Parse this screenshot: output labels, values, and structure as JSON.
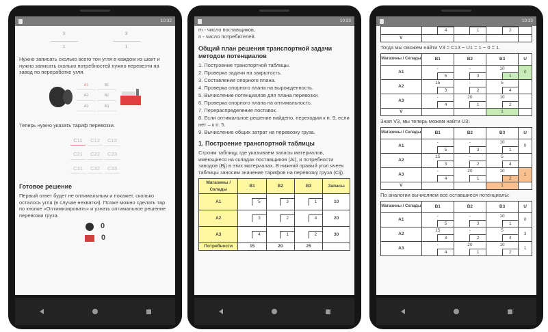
{
  "status": {
    "time1": "10:32",
    "time2": "10:33",
    "time3": "10:33"
  },
  "phone1": {
    "fractions": [
      [
        "3",
        "1"
      ],
      [
        "3",
        "1"
      ]
    ],
    "text1": "Нужно записать сколько всего тон угля в каждом из шахт и нужно записать сколько потребностей нужно перевезти на завод по переработке угля.",
    "mini_cells": [
      "A1",
      "B1",
      "A2",
      "B2",
      "A3",
      "B3"
    ],
    "text2": "Теперь нужно указать тариф перевозки.",
    "tariffs": [
      "C11",
      "C12",
      "C13",
      "C21",
      "C22",
      "C23",
      "C31",
      "C32",
      "C33"
    ],
    "heading": "Готовое решение",
    "text3": "Первый ответ будет не оптимальным и покажет, сколько осталось угля (в случае нехватки). Позже можно сделать тар по кнопке «Оптимизировать» и узнать оптимальное решение перевозки груза.",
    "result1": "0",
    "result2": "0"
  },
  "phone2": {
    "top1": "m - число поставщиков,",
    "top2": "n - число потребителей.",
    "heading1": "Общий план решения транспортной задачи методом потенциалов",
    "steps": [
      "1. Построение транспортной таблицы.",
      "2. Проверка задачи на закрытость.",
      "3. Составление опорного плана.",
      "4. Проверка опорного плана на вырожденность.",
      "5. Вычисление потенциалов для плана перевозки.",
      "6. Проверка опорного плана на оптимальность.",
      "7. Перераспределение поставок.",
      "8. Если оптимальное решение найдено, переходим к п. 9, если нет – к п. 5.",
      "9. Вычисление общих затрат на перевозку груза."
    ],
    "heading2": "1. Построение транспортной таблицы",
    "text": "Строим таблицу, где указываем запасы материалов, имеющиеся на складах поставщиков (Ai), и потребности заводов (Bj) в этих материалах. В нижний правый угол ячеек таблицы заносим значение тарифов на перевозку груза (Cij).",
    "table": {
      "corner": "Магазины / Склады",
      "cols": [
        "B1",
        "B2",
        "B3"
      ],
      "supply_h": "Запасы",
      "rows": [
        {
          "name": "A1",
          "tariffs": [
            "5",
            "3",
            "1"
          ],
          "supply": "10"
        },
        {
          "name": "A2",
          "tariffs": [
            "3",
            "2",
            "4"
          ],
          "supply": "20"
        },
        {
          "name": "A3",
          "tariffs": [
            "4",
            "1",
            "2"
          ],
          "supply": "30"
        }
      ],
      "demand_h": "Потребности",
      "demand": [
        "15",
        "20",
        "25"
      ]
    }
  },
  "phone3": {
    "top_row": [
      "4",
      "1",
      "2"
    ],
    "text1": "Тогда мы сможем найти V3 = C13 − U1 = 1 − 0 = 1.",
    "text2": "Зная V3, мы теперь можем найти U3:",
    "text3": "По аналогии вычисляем все оставшиеся потенциалы:",
    "table": {
      "corner": "Магазины / Склады",
      "cols": [
        "B1",
        "B2",
        "B3"
      ],
      "u_h": "U",
      "v_h": "V",
      "rows": [
        {
          "name": "A1",
          "alloc": [
            "-",
            "-",
            "10"
          ],
          "tariffs": [
            "5",
            "3",
            "1"
          ]
        },
        {
          "name": "A2",
          "alloc": [
            "15",
            "-",
            "5"
          ],
          "tariffs": [
            "3",
            "2",
            "4"
          ]
        },
        {
          "name": "A3",
          "alloc": [
            "-",
            "20",
            "10"
          ],
          "tariffs": [
            "4",
            "1",
            "2"
          ]
        }
      ]
    },
    "t1": {
      "u": [
        "0",
        "",
        ""
      ],
      "v": [
        "",
        "",
        "1"
      ]
    },
    "t2": {
      "u": [
        "0",
        "",
        "1"
      ],
      "v": [
        "",
        "",
        "1"
      ]
    },
    "t3": {
      "u": [
        "0",
        "3",
        "1"
      ]
    }
  },
  "colors": {
    "yellow": "#fff8a0",
    "green": "#c8ecb8",
    "orange": "#f7c08e"
  }
}
